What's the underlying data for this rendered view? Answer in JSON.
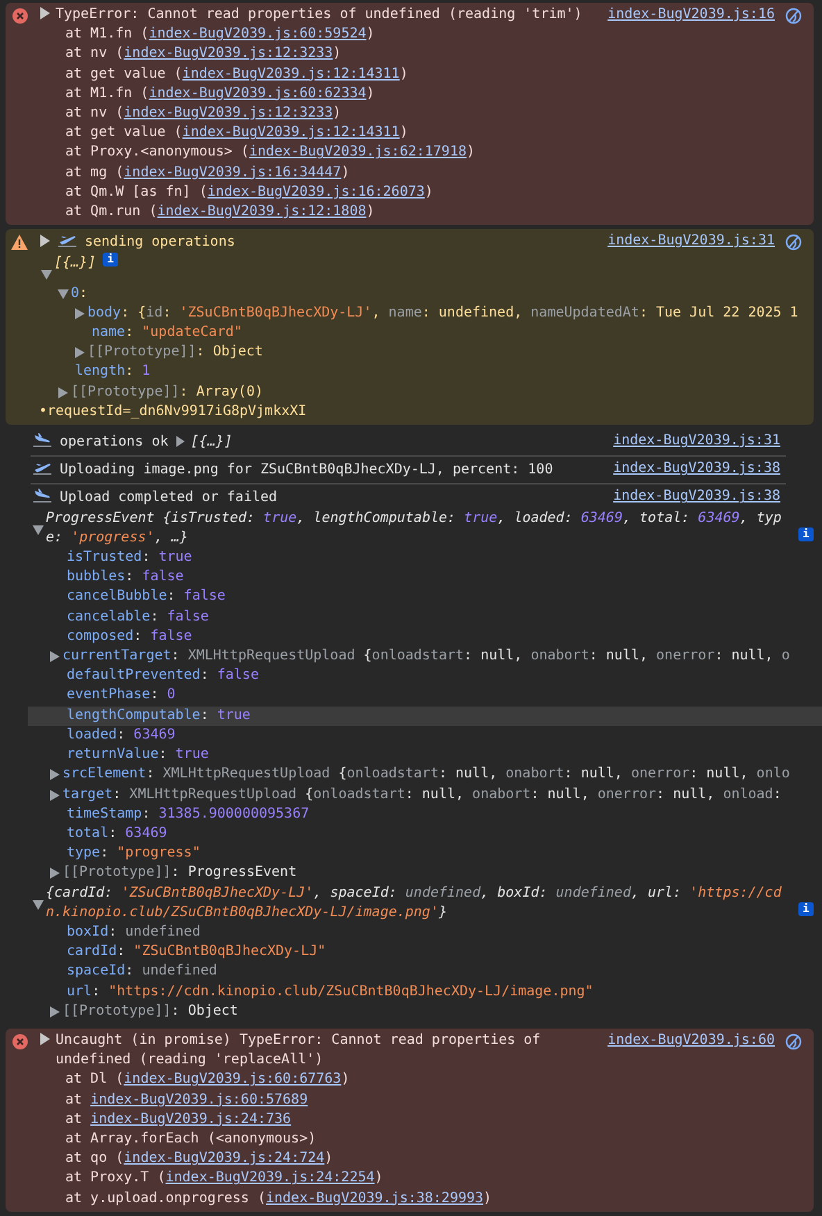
{
  "messages": [
    {
      "kind": "error",
      "expanded": false,
      "text": "TypeError: Cannot read properties of undefined (reading 'trim')",
      "source": "index-BugV2039.js:16",
      "stack": [
        {
          "segments": [
            {
              "text": "at M1.fn (",
              "kind": "plain"
            },
            {
              "text": "index-BugV2039.js:60:59524",
              "kind": "link"
            },
            {
              "text": ")",
              "kind": "plain"
            }
          ]
        },
        {
          "segments": [
            {
              "text": "at nv (",
              "kind": "plain"
            },
            {
              "text": "index-BugV2039.js:12:3233",
              "kind": "link"
            },
            {
              "text": ")",
              "kind": "plain"
            }
          ]
        },
        {
          "segments": [
            {
              "text": "at get value (",
              "kind": "plain"
            },
            {
              "text": "index-BugV2039.js:12:14311",
              "kind": "link"
            },
            {
              "text": ")",
              "kind": "plain"
            }
          ]
        },
        {
          "segments": [
            {
              "text": "at M1.fn (",
              "kind": "plain"
            },
            {
              "text": "index-BugV2039.js:60:62334",
              "kind": "link"
            },
            {
              "text": ")",
              "kind": "plain"
            }
          ]
        },
        {
          "segments": [
            {
              "text": "at nv (",
              "kind": "plain"
            },
            {
              "text": "index-BugV2039.js:12:3233",
              "kind": "link"
            },
            {
              "text": ")",
              "kind": "plain"
            }
          ]
        },
        {
          "segments": [
            {
              "text": "at get value (",
              "kind": "plain"
            },
            {
              "text": "index-BugV2039.js:12:14311",
              "kind": "link"
            },
            {
              "text": ")",
              "kind": "plain"
            }
          ]
        },
        {
          "segments": [
            {
              "text": "at Proxy.<anonymous> (",
              "kind": "plain"
            },
            {
              "text": "index-BugV2039.js:62:17918",
              "kind": "link"
            },
            {
              "text": ")",
              "kind": "plain"
            }
          ]
        },
        {
          "segments": [
            {
              "text": "at mg (",
              "kind": "plain"
            },
            {
              "text": "index-BugV2039.js:16:34447",
              "kind": "link"
            },
            {
              "text": ")",
              "kind": "plain"
            }
          ]
        },
        {
          "segments": [
            {
              "text": "at Qm.W [as fn] (",
              "kind": "plain"
            },
            {
              "text": "index-BugV2039.js:16:26073",
              "kind": "link"
            },
            {
              "text": ")",
              "kind": "plain"
            }
          ]
        },
        {
          "segments": [
            {
              "text": "at Qm.run (",
              "kind": "plain"
            },
            {
              "text": "index-BugV2039.js:12:1808",
              "kind": "link"
            },
            {
              "text": ")",
              "kind": "plain"
            }
          ]
        }
      ]
    },
    {
      "kind": "warning",
      "expanded": false,
      "text": "sending operations",
      "source": "index-BugV2039.js:31",
      "objects": [
        {
          "italic": true,
          "expanded": true,
          "info": "i",
          "segments": [
            {
              "text": "[{…}]",
              "kind": "plain"
            }
          ],
          "children": [
            {
              "expanded": true,
              "segments": [
                {
                  "text": "0",
                  "kind": "key"
                },
                {
                  "text": ":",
                  "kind": "plain"
                }
              ],
              "children": [
                {
                  "expanded": false,
                  "segments": [
                    {
                      "text": "body",
                      "kind": "key"
                    },
                    {
                      "text": ": {",
                      "kind": "plain"
                    },
                    {
                      "text": "id",
                      "kind": "pkey"
                    },
                    {
                      "text": ": ",
                      "kind": "plain"
                    },
                    {
                      "text": "'ZSuCBntB0qBJhecXDy-LJ'",
                      "kind": "str"
                    },
                    {
                      "text": ", ",
                      "kind": "plain"
                    },
                    {
                      "text": "name",
                      "kind": "pkey"
                    },
                    {
                      "text": ": undefined, ",
                      "kind": "plain"
                    },
                    {
                      "text": "nameUpdatedAt",
                      "kind": "pkey"
                    },
                    {
                      "text": ": Tue Jul 22 2025 1",
                      "kind": "plain"
                    }
                  ]
                },
                {
                  "segments": [
                    {
                      "text": "name",
                      "kind": "key"
                    },
                    {
                      "text": ": ",
                      "kind": "plain"
                    },
                    {
                      "text": "\"updateCard\"",
                      "kind": "str"
                    }
                  ]
                },
                {
                  "expanded": false,
                  "segments": [
                    {
                      "text": "[[Prototype]]",
                      "kind": "pkey"
                    },
                    {
                      "text": ": Object",
                      "kind": "plain"
                    }
                  ]
                }
              ]
            },
            {
              "segments": [
                {
                  "text": "length",
                  "kind": "key"
                },
                {
                  "text": ": ",
                  "kind": "plain"
                },
                {
                  "text": "1",
                  "kind": "num"
                }
              ]
            },
            {
              "expanded": false,
              "segments": [
                {
                  "text": "[[Prototype]]",
                  "kind": "pkey"
                },
                {
                  "text": ": Array(0)",
                  "kind": "plain"
                }
              ]
            }
          ]
        }
      ],
      "note": "•requestId=_dn6Nv9917iG8pVjmkxXI"
    },
    {
      "kind": "log",
      "text": "operations ok",
      "inline": "[{…}]",
      "source": "index-BugV2039.js:31"
    },
    {
      "kind": "log",
      "text": "Uploading image.png for ZSuCBntB0qBJhecXDy-LJ, percent: 100",
      "source": "index-BugV2039.js:38"
    },
    {
      "kind": "log",
      "text": "Upload completed or failed",
      "source": "index-BugV2039.js:38",
      "objects": [
        {
          "italic": true,
          "expanded": true,
          "info": "i",
          "segments": [
            {
              "text": "ProgressEvent {isTrusted: ",
              "kind": "plain"
            },
            {
              "text": "true",
              "kind": "num"
            },
            {
              "text": ", lengthComputable: ",
              "kind": "plain"
            },
            {
              "text": "true",
              "kind": "num"
            },
            {
              "text": ", loaded: ",
              "kind": "plain"
            },
            {
              "text": "63469",
              "kind": "num"
            },
            {
              "text": ", total: ",
              "kind": "plain"
            },
            {
              "text": "63469",
              "kind": "num"
            },
            {
              "text": ", type: ",
              "kind": "plain"
            },
            {
              "text": "'progress'",
              "kind": "str"
            },
            {
              "text": ", …}",
              "kind": "plain"
            }
          ],
          "children": [
            {
              "segments": [
                {
                  "text": "isTrusted",
                  "kind": "key"
                },
                {
                  "text": ": ",
                  "kind": "plain"
                },
                {
                  "text": "true",
                  "kind": "num"
                }
              ]
            },
            {
              "segments": [
                {
                  "text": "bubbles",
                  "kind": "key"
                },
                {
                  "text": ": ",
                  "kind": "plain"
                },
                {
                  "text": "false",
                  "kind": "num"
                }
              ]
            },
            {
              "segments": [
                {
                  "text": "cancelBubble",
                  "kind": "key"
                },
                {
                  "text": ": ",
                  "kind": "plain"
                },
                {
                  "text": "false",
                  "kind": "num"
                }
              ]
            },
            {
              "segments": [
                {
                  "text": "cancelable",
                  "kind": "key"
                },
                {
                  "text": ": ",
                  "kind": "plain"
                },
                {
                  "text": "false",
                  "kind": "num"
                }
              ]
            },
            {
              "segments": [
                {
                  "text": "composed",
                  "kind": "key"
                },
                {
                  "text": ": ",
                  "kind": "plain"
                },
                {
                  "text": "false",
                  "kind": "num"
                }
              ]
            },
            {
              "expanded": false,
              "segments": [
                {
                  "text": "currentTarget",
                  "kind": "key"
                },
                {
                  "text": ": ",
                  "kind": "plain"
                },
                {
                  "text": "XMLHttpRequestUpload",
                  "kind": "pkey"
                },
                {
                  "text": " {",
                  "kind": "plain"
                },
                {
                  "text": "onloadstart",
                  "kind": "pkey"
                },
                {
                  "text": ": null, ",
                  "kind": "plain"
                },
                {
                  "text": "onabort",
                  "kind": "pkey"
                },
                {
                  "text": ": null, ",
                  "kind": "plain"
                },
                {
                  "text": "onerror",
                  "kind": "pkey"
                },
                {
                  "text": ": null, ",
                  "kind": "plain"
                },
                {
                  "text": "o",
                  "kind": "pkey"
                }
              ]
            },
            {
              "segments": [
                {
                  "text": "defaultPrevented",
                  "kind": "key"
                },
                {
                  "text": ": ",
                  "kind": "plain"
                },
                {
                  "text": "false",
                  "kind": "num"
                }
              ]
            },
            {
              "segments": [
                {
                  "text": "eventPhase",
                  "kind": "key"
                },
                {
                  "text": ": ",
                  "kind": "plain"
                },
                {
                  "text": "0",
                  "kind": "num"
                }
              ]
            },
            {
              "highlighted": true,
              "segments": [
                {
                  "text": "lengthComputable",
                  "kind": "key"
                },
                {
                  "text": ": ",
                  "kind": "plain"
                },
                {
                  "text": "true",
                  "kind": "num"
                }
              ]
            },
            {
              "segments": [
                {
                  "text": "loaded",
                  "kind": "key"
                },
                {
                  "text": ": ",
                  "kind": "plain"
                },
                {
                  "text": "63469",
                  "kind": "num"
                }
              ]
            },
            {
              "segments": [
                {
                  "text": "returnValue",
                  "kind": "key"
                },
                {
                  "text": ": ",
                  "kind": "plain"
                },
                {
                  "text": "true",
                  "kind": "num"
                }
              ]
            },
            {
              "expanded": false,
              "segments": [
                {
                  "text": "srcElement",
                  "kind": "key"
                },
                {
                  "text": ": ",
                  "kind": "plain"
                },
                {
                  "text": "XMLHttpRequestUpload",
                  "kind": "pkey"
                },
                {
                  "text": " {",
                  "kind": "plain"
                },
                {
                  "text": "onloadstart",
                  "kind": "pkey"
                },
                {
                  "text": ": null, ",
                  "kind": "plain"
                },
                {
                  "text": "onabort",
                  "kind": "pkey"
                },
                {
                  "text": ": null, ",
                  "kind": "plain"
                },
                {
                  "text": "onerror",
                  "kind": "pkey"
                },
                {
                  "text": ": null, ",
                  "kind": "plain"
                },
                {
                  "text": "onlo",
                  "kind": "pkey"
                }
              ]
            },
            {
              "expanded": false,
              "segments": [
                {
                  "text": "target",
                  "kind": "key"
                },
                {
                  "text": ": ",
                  "kind": "plain"
                },
                {
                  "text": "XMLHttpRequestUpload",
                  "kind": "pkey"
                },
                {
                  "text": " {",
                  "kind": "plain"
                },
                {
                  "text": "onloadstart",
                  "kind": "pkey"
                },
                {
                  "text": ": null, ",
                  "kind": "plain"
                },
                {
                  "text": "onabort",
                  "kind": "pkey"
                },
                {
                  "text": ": null, ",
                  "kind": "plain"
                },
                {
                  "text": "onerror",
                  "kind": "pkey"
                },
                {
                  "text": ": null, ",
                  "kind": "plain"
                },
                {
                  "text": "onload",
                  "kind": "pkey"
                },
                {
                  "text": ":",
                  "kind": "plain"
                }
              ]
            },
            {
              "segments": [
                {
                  "text": "timeStamp",
                  "kind": "key"
                },
                {
                  "text": ": ",
                  "kind": "plain"
                },
                {
                  "text": "31385.900000095367",
                  "kind": "num"
                }
              ]
            },
            {
              "segments": [
                {
                  "text": "total",
                  "kind": "key"
                },
                {
                  "text": ": ",
                  "kind": "plain"
                },
                {
                  "text": "63469",
                  "kind": "num"
                }
              ]
            },
            {
              "segments": [
                {
                  "text": "type",
                  "kind": "key"
                },
                {
                  "text": ": ",
                  "kind": "plain"
                },
                {
                  "text": "\"progress\"",
                  "kind": "str"
                }
              ]
            },
            {
              "expanded": false,
              "segments": [
                {
                  "text": "[[Prototype]]",
                  "kind": "pkey"
                },
                {
                  "text": ": ProgressEvent",
                  "kind": "plain"
                }
              ]
            }
          ]
        },
        {
          "italic": true,
          "expanded": true,
          "info": "i",
          "segments": [
            {
              "text": "{cardId: ",
              "kind": "plain"
            },
            {
              "text": "'ZSuCBntB0qBJhecXDy-LJ'",
              "kind": "str"
            },
            {
              "text": ", spaceId: ",
              "kind": "plain"
            },
            {
              "text": "undefined",
              "kind": "undef"
            },
            {
              "text": ", boxId: ",
              "kind": "plain"
            },
            {
              "text": "undefined",
              "kind": "undef"
            },
            {
              "text": ", url: ",
              "kind": "plain"
            },
            {
              "text": "'https://cdn.kinopio.club/ZSuCBntB0qBJhecXDy-LJ/image.png'",
              "kind": "str"
            },
            {
              "text": "}",
              "kind": "plain"
            }
          ],
          "children": [
            {
              "segments": [
                {
                  "text": "boxId",
                  "kind": "key"
                },
                {
                  "text": ": ",
                  "kind": "plain"
                },
                {
                  "text": "undefined",
                  "kind": "undef"
                }
              ]
            },
            {
              "segments": [
                {
                  "text": "cardId",
                  "kind": "key"
                },
                {
                  "text": ": ",
                  "kind": "plain"
                },
                {
                  "text": "\"ZSuCBntB0qBJhecXDy-LJ\"",
                  "kind": "str"
                }
              ]
            },
            {
              "segments": [
                {
                  "text": "spaceId",
                  "kind": "key"
                },
                {
                  "text": ": ",
                  "kind": "plain"
                },
                {
                  "text": "undefined",
                  "kind": "undef"
                }
              ]
            },
            {
              "segments": [
                {
                  "text": "url",
                  "kind": "key"
                },
                {
                  "text": ": ",
                  "kind": "plain"
                },
                {
                  "text": "\"https://cdn.kinopio.club/ZSuCBntB0qBJhecXDy-LJ/image.png\"",
                  "kind": "str"
                }
              ]
            },
            {
              "expanded": false,
              "segments": [
                {
                  "text": "[[Prototype]]",
                  "kind": "pkey"
                },
                {
                  "text": ": Object",
                  "kind": "plain"
                }
              ]
            }
          ]
        }
      ]
    },
    {
      "kind": "error",
      "expanded": false,
      "text": "Uncaught (in promise) TypeError: Cannot read properties of undefined (reading 'replaceAll')",
      "source": "index-BugV2039.js:60",
      "stack": [
        {
          "segments": [
            {
              "text": "at Dl (",
              "kind": "plain"
            },
            {
              "text": "index-BugV2039.js:60:67763",
              "kind": "link"
            },
            {
              "text": ")",
              "kind": "plain"
            }
          ]
        },
        {
          "segments": [
            {
              "text": "at ",
              "kind": "plain"
            },
            {
              "text": "index-BugV2039.js:60:57689",
              "kind": "link"
            }
          ]
        },
        {
          "segments": [
            {
              "text": "at ",
              "kind": "plain"
            },
            {
              "text": "index-BugV2039.js:24:736",
              "kind": "link"
            }
          ]
        },
        {
          "segments": [
            {
              "text": "at Array.forEach (<anonymous>)",
              "kind": "plain"
            }
          ]
        },
        {
          "segments": [
            {
              "text": "at qo (",
              "kind": "plain"
            },
            {
              "text": "index-BugV2039.js:24:724",
              "kind": "link"
            },
            {
              "text": ")",
              "kind": "plain"
            }
          ]
        },
        {
          "segments": [
            {
              "text": "at Proxy.T (",
              "kind": "plain"
            },
            {
              "text": "index-BugV2039.js:24:2254",
              "kind": "link"
            },
            {
              "text": ")",
              "kind": "plain"
            }
          ]
        },
        {
          "segments": [
            {
              "text": "at y.upload.onprogress (",
              "kind": "plain"
            },
            {
              "text": "index-BugV2039.js:38:29993",
              "kind": "link"
            },
            {
              "text": ")",
              "kind": "plain"
            }
          ]
        }
      ]
    }
  ]
}
